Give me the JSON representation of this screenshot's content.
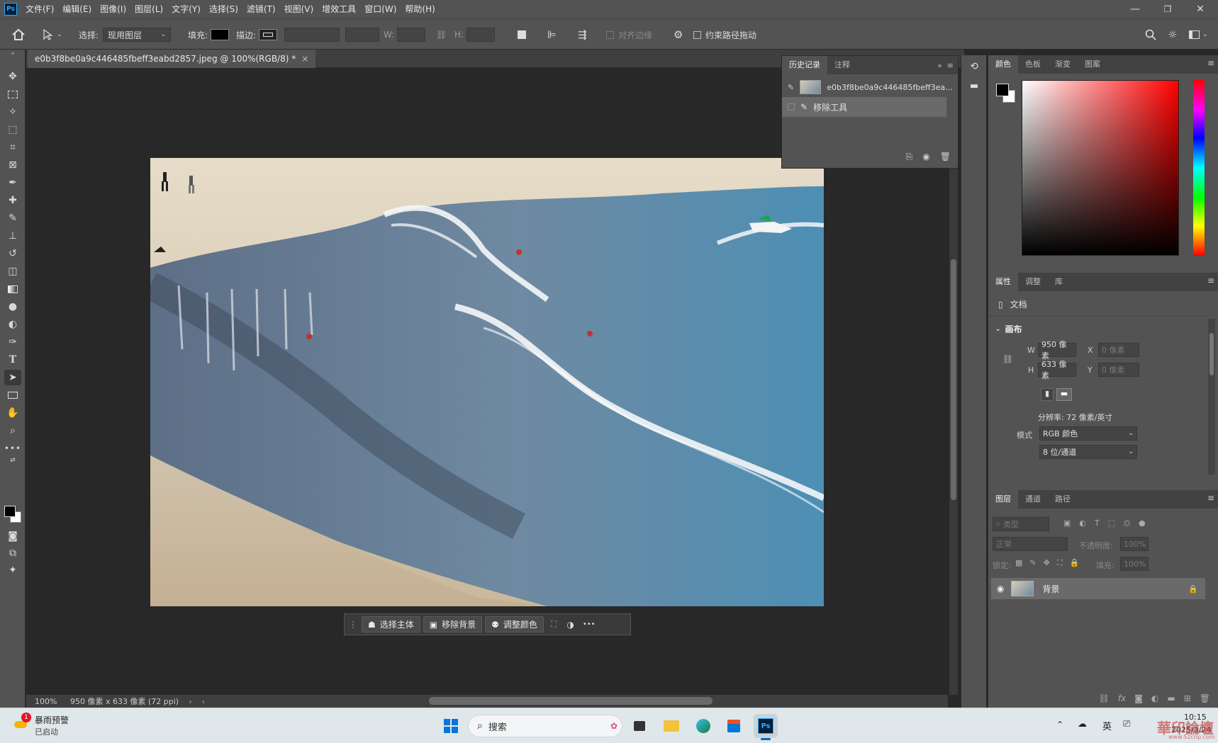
{
  "menubar": {
    "app_icon": "Ps",
    "items": [
      "文件(F)",
      "编辑(E)",
      "图像(I)",
      "图层(L)",
      "文字(Y)",
      "选择(S)",
      "滤镜(T)",
      "视图(V)",
      "增效工具",
      "窗口(W)",
      "帮助(H)"
    ]
  },
  "optbar": {
    "select_label": "选择:",
    "select_value": "现用图层",
    "fill_label": "填充:",
    "stroke_label": "描边:",
    "w_label": "W:",
    "h_label": "H:",
    "align_edges": "对齐边缘",
    "constrain_path": "约束路径拖动"
  },
  "document": {
    "tab_title": "e0b3f8be0a9c446485fbeff3eabd2857.jpeg @ 100%(RGB/8) *",
    "close_icon": "×"
  },
  "context_bar": {
    "select_subject": "选择主体",
    "remove_bg": "移除背景",
    "adjust_color": "调整颜色",
    "more": "•••"
  },
  "status": {
    "zoom": "100%",
    "info": "950 像素 x 633 像素 (72 ppi)"
  },
  "history_panel": {
    "tabs": [
      "历史记录",
      "注释"
    ],
    "snapshot_label": "e0b3f8be0a9c446485fbeff3ea...",
    "step_label": "移除工具"
  },
  "color_panel": {
    "tabs": [
      "颜色",
      "色板",
      "渐变",
      "图案"
    ],
    "fg_color": "#000000",
    "bg_color": "#ffffff"
  },
  "properties_panel": {
    "tabs": [
      "属性",
      "调整",
      "库"
    ],
    "doc_label": "文档",
    "canvas_label": "画布",
    "w_label": "W",
    "w_value": "950 像素",
    "h_label": "H",
    "h_value": "633 像素",
    "x_label": "X",
    "x_value": "0 像素",
    "y_label": "Y",
    "y_value": "0 像素",
    "resolution": "分辨率: 72 像素/英寸",
    "mode_label": "模式",
    "mode_value": "RGB 颜色",
    "depth_value": "8 位/通道"
  },
  "layers_panel": {
    "tabs": [
      "图层",
      "通道",
      "路径"
    ],
    "filter_placeholder": "类型",
    "blend_mode": "正常",
    "opacity_label": "不透明度:",
    "opacity_value": "100%",
    "lock_label": "锁定:",
    "fill_label": "填充:",
    "fill_value": "100%",
    "layer_name": "背景"
  },
  "taskbar": {
    "weather_badge": "1",
    "weather_title": "暴雨预警",
    "weather_sub": "已启动",
    "search_placeholder": "搜索",
    "lang": "英",
    "time": "10:15",
    "date": "2025/3/24",
    "watermark": "華印論壇",
    "watermark_url": "www.52cnp.com"
  }
}
